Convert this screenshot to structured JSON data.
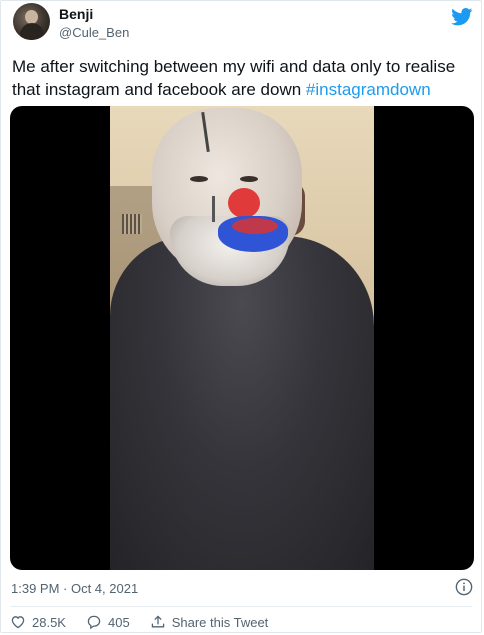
{
  "author": {
    "name": "Benji",
    "handle": "@Cule_Ben"
  },
  "tweet": {
    "text": "Me after switching between my wifi and data only to realise that instagram and facebook are down ",
    "hashtag": "#instagramdown",
    "timestamp": "1:39 PM · Oct 4, 2021"
  },
  "actions": {
    "likes": "28.5K",
    "replies": "405",
    "share_label": "Share this Tweet"
  },
  "icons": {
    "brand": "twitter-bird-icon",
    "info": "info-icon",
    "like": "heart-icon",
    "reply": "comment-icon",
    "share": "share-icon"
  },
  "colors": {
    "accent": "#1d9bf0",
    "text": "#0f1419",
    "muted": "#536471"
  }
}
